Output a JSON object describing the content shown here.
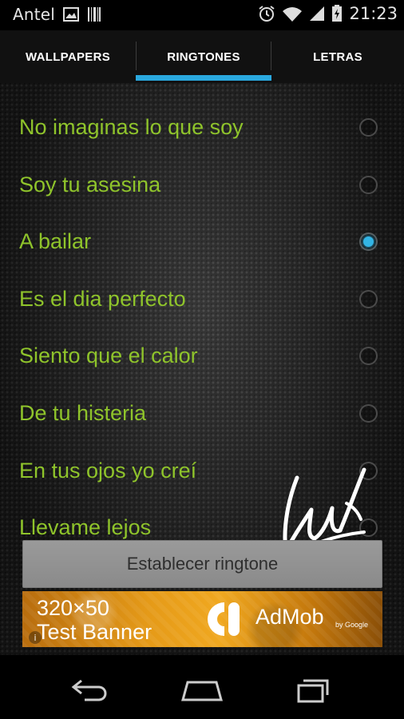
{
  "status_bar": {
    "carrier": "Antel",
    "time": "21:23",
    "icons": [
      "image-icon",
      "barcode-icon",
      "alarm-icon",
      "wifi-icon",
      "signal-icon",
      "battery-charging-icon"
    ]
  },
  "tabs": [
    {
      "label": "WALLPAPERS",
      "selected": false
    },
    {
      "label": "RINGTONES",
      "selected": true
    },
    {
      "label": "LETRAS",
      "selected": false
    }
  ],
  "ringtones": [
    {
      "title": "No imaginas lo que soy",
      "selected": false
    },
    {
      "title": "Soy tu asesina",
      "selected": false
    },
    {
      "title": "A bailar",
      "selected": true
    },
    {
      "title": "Es el dia perfecto",
      "selected": false
    },
    {
      "title": "Siento que el calor",
      "selected": false
    },
    {
      "title": "De tu histeria",
      "selected": false
    },
    {
      "title": "En tus ojos yo creí",
      "selected": false
    },
    {
      "title": "Llevame lejos",
      "selected": false
    }
  ],
  "set_button_label": "Establecer ringtone",
  "ad": {
    "line1": "320×50",
    "line2": "Test Banner",
    "brand": "AdMob",
    "brand_by": "by Google",
    "info_icon": "info-icon"
  },
  "nav": {
    "icons": [
      "back-icon",
      "home-icon",
      "recent-apps-icon"
    ]
  },
  "colors": {
    "accent": "#33b5e5",
    "tab_indicator": "#2aa9df",
    "song_text": "#8fc42b",
    "ad_orange": "#e59a18"
  }
}
